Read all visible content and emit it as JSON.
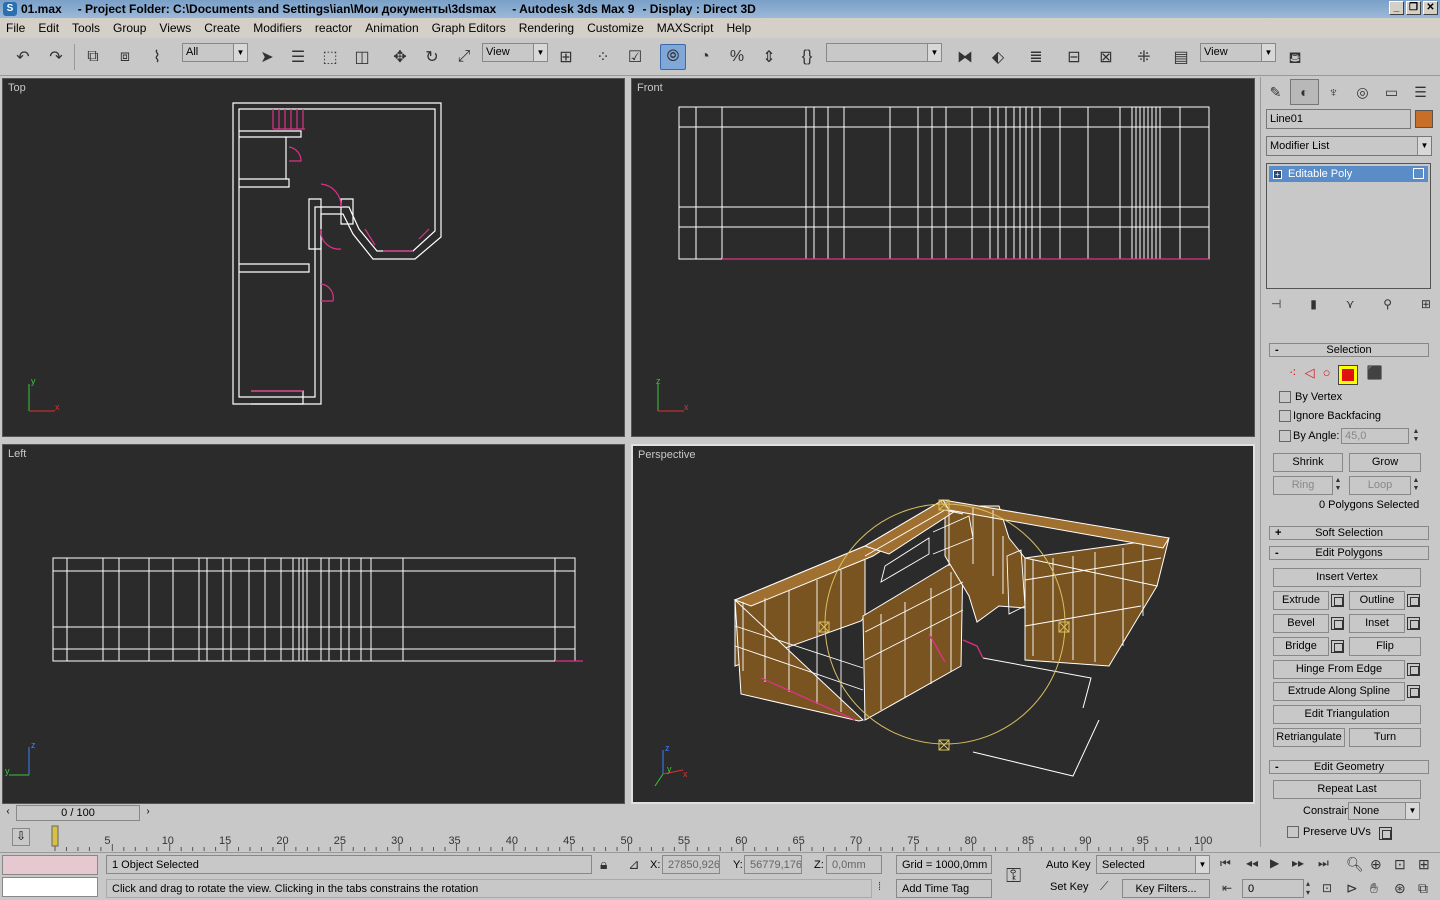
{
  "title": {
    "file": "01.max",
    "project": "- Project Folder: C:\\Documents and Settings\\ian\\Мои документы\\3dsmax",
    "app": "- Autodesk 3ds Max 9",
    "display": "- Display : Direct 3D"
  },
  "menu": [
    "File",
    "Edit",
    "Tools",
    "Group",
    "Views",
    "Create",
    "Modifiers",
    "reactor",
    "Animation",
    "Graph Editors",
    "Rendering",
    "Customize",
    "MAXScript",
    "Help"
  ],
  "toolbar": {
    "selection_filter": "All",
    "ref_coord": "View",
    "named_selection": "",
    "view_select": "View"
  },
  "viewports": {
    "top": {
      "label": "Top"
    },
    "front": {
      "label": "Front"
    },
    "left": {
      "label": "Left"
    },
    "perspective": {
      "label": "Perspective"
    }
  },
  "command_panel": {
    "object_name": "Line01",
    "object_color": "#c86e28",
    "modifier_list": "Modifier List",
    "stack_item": "Editable Poly",
    "selection": {
      "title": "Selection",
      "by_vertex": "By Vertex",
      "ignore_backfacing": "Ignore Backfacing",
      "by_angle": "By Angle:",
      "angle_value": "45,0",
      "shrink": "Shrink",
      "grow": "Grow",
      "ring": "Ring",
      "loop": "Loop",
      "status": "0 Polygons Selected"
    },
    "soft_selection": "Soft Selection",
    "edit_polygons": {
      "title": "Edit Polygons",
      "insert_vertex": "Insert Vertex",
      "extrude": "Extrude",
      "outline": "Outline",
      "bevel": "Bevel",
      "inset": "Inset",
      "bridge": "Bridge",
      "flip": "Flip",
      "hinge": "Hinge From Edge",
      "extrude_spline": "Extrude Along Spline",
      "edit_triangulation": "Edit Triangulation",
      "retriangulate": "Retriangulate",
      "turn": "Turn"
    },
    "edit_geometry": {
      "title": "Edit Geometry",
      "repeat_last": "Repeat Last",
      "constraints": "Constraints:",
      "constraints_value": "None",
      "preserve_uvs": "Preserve UVs"
    }
  },
  "time": {
    "frame": "0 / 100",
    "ticks": [
      "5",
      "10",
      "15",
      "20",
      "25",
      "30",
      "35",
      "40",
      "45",
      "50",
      "55",
      "60",
      "65",
      "70",
      "75",
      "80",
      "85",
      "90",
      "95",
      "100"
    ]
  },
  "status": {
    "selected": "1 Object Selected",
    "prompt": "Click and drag to rotate the view.  Clicking in the tabs constrains the rotation",
    "x_label": "X:",
    "x_value": "27850,926",
    "y_label": "Y:",
    "y_value": "56779,176",
    "z_label": "Z:",
    "z_value": "0,0mm",
    "grid": "Grid = 1000,0mm",
    "add_time_tag": "Add Time Tag",
    "auto_key": "Auto Key",
    "set_key": "Set Key",
    "key_mode": "Selected",
    "key_filters": "Key Filters...",
    "current_frame": "0"
  }
}
